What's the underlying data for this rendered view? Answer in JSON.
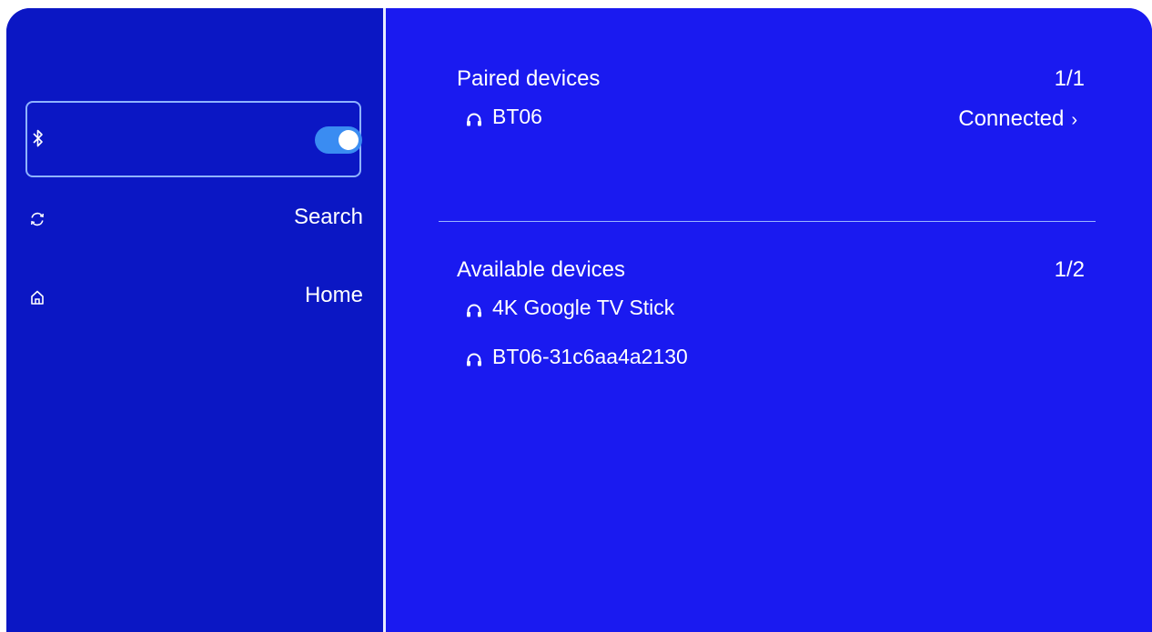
{
  "sidebar": {
    "bluetooth": {
      "icon": "bluetooth-icon",
      "enabled": true
    },
    "items": [
      {
        "icon": "refresh-icon",
        "label": "Search"
      },
      {
        "icon": "home-icon",
        "label": "Home"
      }
    ]
  },
  "paired": {
    "title": "Paired devices",
    "count": "1/1",
    "devices": [
      {
        "icon": "headphones-icon",
        "name": "BT06",
        "status": "Connected"
      }
    ]
  },
  "available": {
    "title": "Available devices",
    "count": "1/2",
    "devices": [
      {
        "icon": "headphones-icon",
        "name": "4K Google TV Stick"
      },
      {
        "icon": "headphones-icon",
        "name": "BT06-31c6aa4a2130"
      }
    ]
  },
  "colors": {
    "content_bg": "#1a1af0",
    "sidebar_bg": "#0b17c4",
    "toggle_on": "#3a8cf2",
    "focus_border": "#8fb3ff"
  }
}
